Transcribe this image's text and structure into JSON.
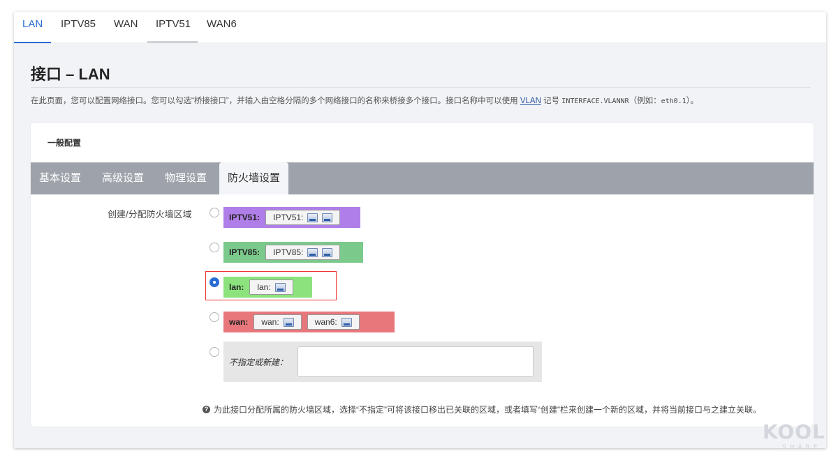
{
  "top_tabs": [
    "LAN",
    "IPTV85",
    "WAN",
    "IPTV51",
    "WAN6"
  ],
  "page": {
    "title": "接口 – LAN",
    "desc_part1": "在此页面，您可以配置网络接口。您可以勾选“桥接接口”，并输入由空格分隔的多个网络接口的名称来桥接多个接口。接口名称中可以使用 ",
    "desc_link": "VLAN",
    "desc_part2": " 记号 ",
    "desc_code1": "INTERFACE.VLANNR",
    "desc_part3": "（例如：",
    "desc_code2": "eth0.1",
    "desc_part4": "）。"
  },
  "section": {
    "title": "一般配置",
    "tabs": [
      "基本设置",
      "高级设置",
      "物理设置",
      "防火墙设置"
    ]
  },
  "firewall": {
    "label": "创建/分配防火墙区域",
    "zones": [
      {
        "name": "IPTV51:",
        "color": "#b07ee8",
        "interfaces": [
          {
            "label": "IPTV51:",
            "icons": [
              "network-icon",
              "network-icon"
            ]
          }
        ]
      },
      {
        "name": "IPTV85:",
        "color": "#7cc98c",
        "interfaces": [
          {
            "label": "IPTV85:",
            "icons": [
              "network-icon",
              "network-icon"
            ]
          }
        ]
      },
      {
        "name": "lan:",
        "color": "#8ce37e",
        "interfaces": [
          {
            "label": "lan:",
            "icons": [
              "ethernet-icon"
            ]
          }
        ]
      },
      {
        "name": "wan:",
        "color": "#e8777c",
        "interfaces": [
          {
            "label": "wan:",
            "icons": [
              "ethernet-icon"
            ]
          },
          {
            "label": "wan6:",
            "icons": [
              "ethernet-icon"
            ]
          }
        ]
      }
    ],
    "selected": "lan:",
    "unspecified_label": "不指定或新建：",
    "help_text": "为此接口分配所属的防火墙区域，选择“不指定”可将该接口移出已关联的区域，或者填写“创建”栏来创建一个新的区域，并将当前接口与之建立关联。"
  },
  "watermark": {
    "main": "KOOL",
    "sub": "SHARE"
  }
}
